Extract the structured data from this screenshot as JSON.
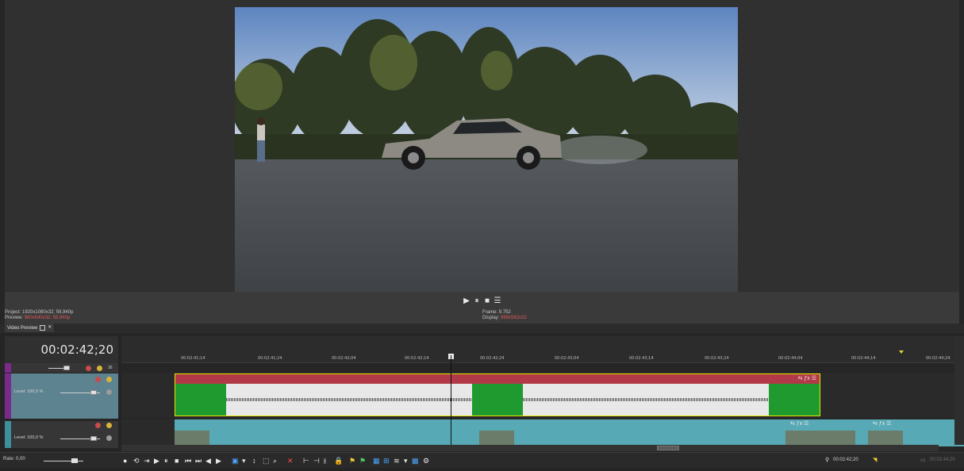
{
  "preview": {
    "transport": {
      "play": "▶",
      "pause": "⏸",
      "stop": "■",
      "menu": "☰"
    },
    "project_label": "Project:",
    "project_value": "1920x1080x32; 59,940p",
    "preview_label": "Preview:",
    "preview_value": "960x540x32; 59,940p",
    "frame_label": "Frame:",
    "frame_value": "9.752",
    "display_label": "Display:",
    "display_value": "999x562x32",
    "tab_label": "Video Preview"
  },
  "timeline": {
    "timecode": "00:02:42;20",
    "ruler_labels": [
      "00:02:41;14",
      "00:02:41;24",
      "00:02:42;04",
      "00:02:42;14",
      "00:02:42;24",
      "00:02:43;04",
      "00:02:43;14",
      "00:02:43;24",
      "00:02:44;04",
      "00:02:44;14",
      "00:02:44;24"
    ],
    "track1_level": "Level: 100,0 %",
    "track2_level": "Level: 100,0 %",
    "track_header_number": "36",
    "rate_label": "Rate: 0,00",
    "cursor_timecode": "00:02:42;20",
    "end_timecode": "00:02:44;20"
  },
  "colors": {
    "audio_clip_header": "#b23a48",
    "audio_clip_green": "#1f9a2e",
    "audio_clip_body": "#e8e8e8",
    "video_clip": "#57a9b5",
    "track_stripe_1": "#7a2a8a",
    "track_stripe_2": "#3d8f9a",
    "selection_border": "#e6e600"
  }
}
